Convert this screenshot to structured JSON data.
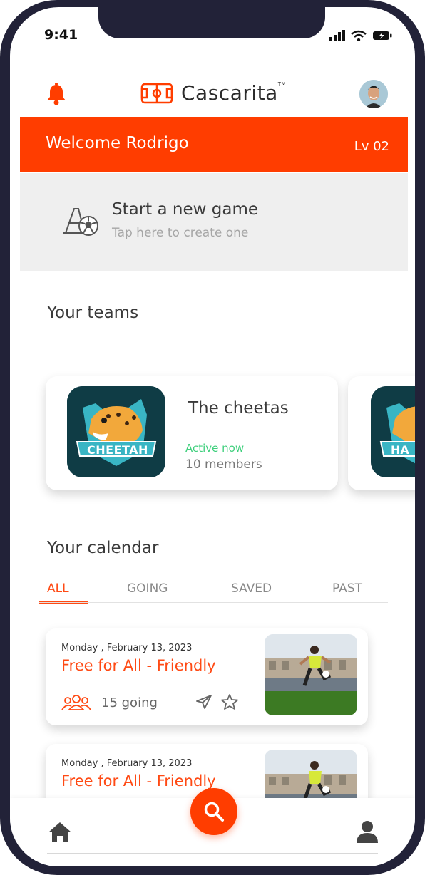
{
  "status_bar": {
    "time": "9:41"
  },
  "app": {
    "logo_text": "Cascarita",
    "trademark": "TM",
    "brand_color": "#ff3d00"
  },
  "welcome": {
    "text": "Welcome Rodrigo",
    "level": "Lv 02"
  },
  "new_game": {
    "title": "Start a new game",
    "subtitle": "Tap here to create one"
  },
  "teams": {
    "section_title": "Your teams",
    "items": [
      {
        "name": "The cheetas",
        "status": "Active now",
        "members": "10 members",
        "badge_text": "CHEETAH"
      },
      {
        "name": "",
        "status": "",
        "members": "",
        "badge_text": "HA"
      }
    ]
  },
  "calendar": {
    "section_title": "Your calendar",
    "tabs": [
      {
        "label": "ALL",
        "active": true
      },
      {
        "label": "GOING",
        "active": false
      },
      {
        "label": "SAVED",
        "active": false
      },
      {
        "label": "PAST",
        "active": false
      }
    ],
    "events": [
      {
        "date": "Monday , February 13, 2023",
        "title": "Free for All - Friendly",
        "going": "15 going"
      },
      {
        "date": "Monday , February 13, 2023",
        "title": "Free for All - Friendly",
        "going": ""
      }
    ]
  },
  "bottom_nav": {
    "home_icon": "home-icon",
    "search_icon": "search-icon",
    "profile_icon": "profile-icon"
  }
}
